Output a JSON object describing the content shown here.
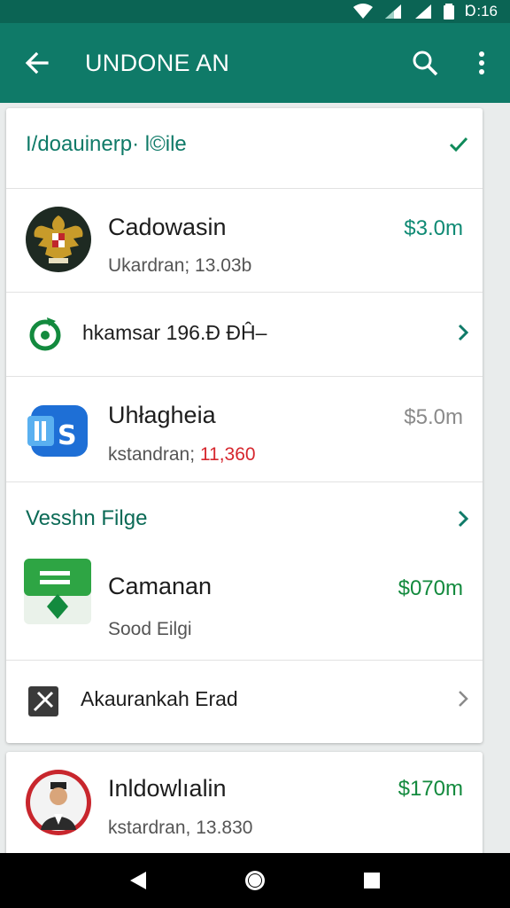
{
  "status_bar": {
    "time": "Ɒ:16"
  },
  "app_bar": {
    "title": "UNDONE AN"
  },
  "card1": {
    "header": "I/doauinerp· l©ile",
    "items": [
      {
        "primary": "Cadowasin",
        "secondary": "Ukardran; 13.03b",
        "amount": "$3.0m"
      },
      {
        "inline": "hkamsar 196.Ð ÐĤ–"
      },
      {
        "primary": "Uhłagheia",
        "secondary_prefix": "kstandran; ",
        "secondary_highlight": "11,360",
        "amount": "$5.0m"
      }
    ],
    "section2_title": "Vesshn Filge",
    "items2": [
      {
        "primary": "Camanan",
        "secondary": "Sood Eilgi",
        "amount": "$070m"
      },
      {
        "inline": "Akaurankah Erad"
      }
    ]
  },
  "card2": {
    "item": {
      "primary": "Inldowlıalin",
      "secondary": "kstardran, 13.830",
      "amount": "$170m"
    }
  },
  "colors": {
    "app_bar": "#0f7a68",
    "status_bar": "#0b6454",
    "accent_teal": "#0f8a74",
    "amount_green": "#138a3e",
    "amount_grey": "#8a8a8a",
    "highlight_red": "#d6262d"
  },
  "icons": [
    "back-arrow-icon",
    "search-icon",
    "more-vert-icon",
    "check-icon",
    "chevron-right-icon",
    "wifi-icon",
    "signal-icon",
    "battery-icon",
    "nav-back-icon",
    "nav-home-icon",
    "nav-recents-icon"
  ]
}
